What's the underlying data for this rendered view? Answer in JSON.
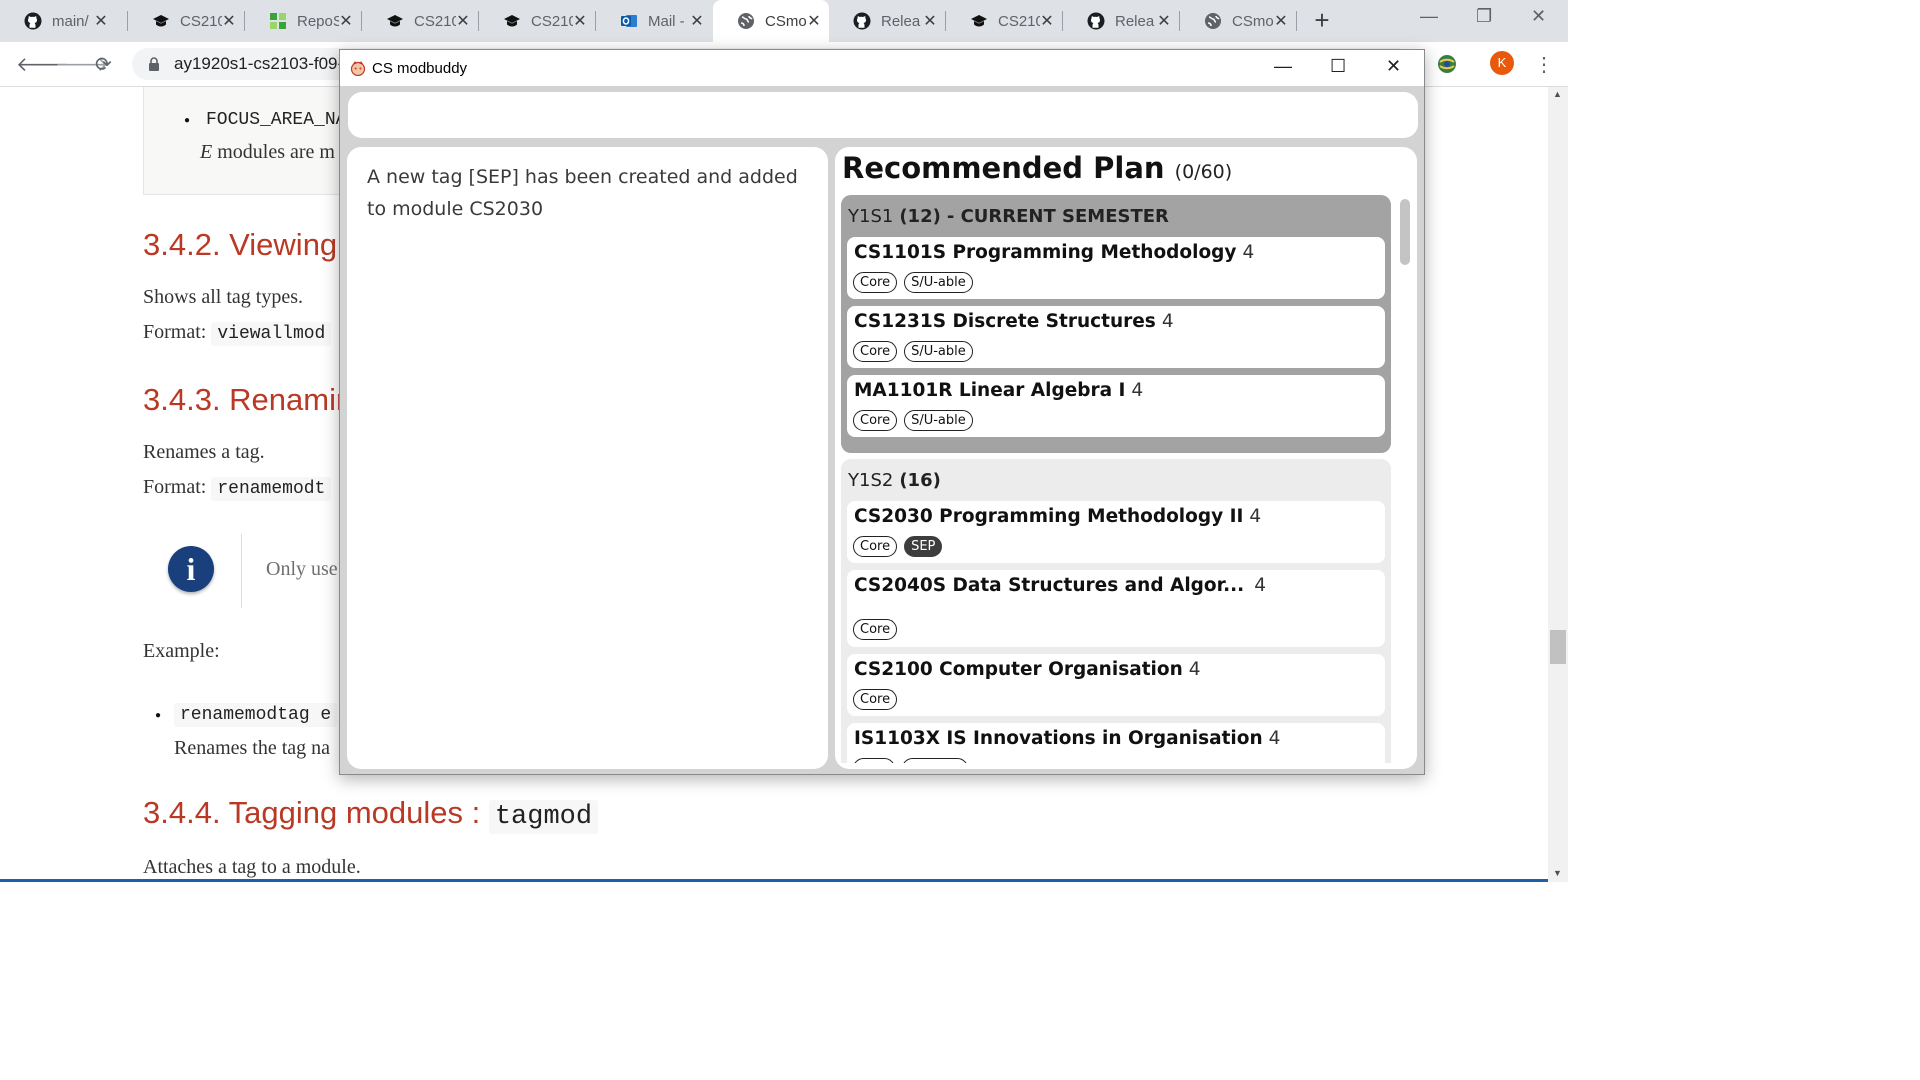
{
  "browser": {
    "tabs": [
      {
        "title": "main/",
        "icon": "github-icon"
      },
      {
        "title": "CS210",
        "icon": "graduation-cap-icon"
      },
      {
        "title": "RepoS",
        "icon": "reposense-icon"
      },
      {
        "title": "CS210",
        "icon": "graduation-cap-icon"
      },
      {
        "title": "CS210",
        "icon": "graduation-cap-icon"
      },
      {
        "title": "Mail -",
        "icon": "outlook-icon"
      },
      {
        "title": "CSmo",
        "icon": "globe-icon"
      },
      {
        "title": "Relea",
        "icon": "github-icon"
      },
      {
        "title": "CS210",
        "icon": "graduation-cap-icon"
      },
      {
        "title": "Relea",
        "icon": "github-icon"
      },
      {
        "title": "CSmo",
        "icon": "globe-icon"
      }
    ],
    "active_tab_index": 6,
    "new_tab_label": "+",
    "url": "ay1920s1-cs2103-f09-",
    "profile_initial": "K",
    "colors": {
      "tabstrip": "#dee1e6",
      "avatar": "#e8590c"
    }
  },
  "doc": {
    "focus_item": "FOCUS_AREA_NA",
    "focus_note_em": "E",
    "focus_note_rest": "modules are m",
    "h_viewing": "3.4.2. Viewing",
    "p_shows": "Shows all tag types.",
    "format_label": "Format:",
    "code_viewall": "viewallmod",
    "h_renaming": "3.4.3. Renamir",
    "p_renames": "Renames a tag.",
    "code_rename": "renamemodt",
    "note_text": "Only use",
    "example_label": "Example:",
    "ex_code": "renamemodtag e",
    "ex_desc": "Renames the tag na",
    "h_tagging": "3.4.4. Tagging modules :",
    "h_tagging_code": "tagmod",
    "p_attaches": "Attaches a tag to a module.",
    "colors": {
      "heading": "#ba3925",
      "admonition": "#19407c"
    }
  },
  "app": {
    "title": "CS modbuddy",
    "command_value": "",
    "result_text": "A new tag [SEP] has been created and added to module CS2030",
    "plan": {
      "title": "Recommended Plan",
      "credits": "(0/60)",
      "semesters": [
        {
          "name": "Y1S1",
          "credits": "(12)",
          "current_label": "- CURRENT SEMESTER",
          "modules": [
            {
              "code_name": "CS1101S Programming Methodology",
              "mc": "4",
              "tags": [
                "Core",
                "S/U-able"
              ]
            },
            {
              "code_name": "CS1231S Discrete Structures",
              "mc": "4",
              "tags": [
                "Core",
                "S/U-able"
              ]
            },
            {
              "code_name": "MA1101R Linear Algebra I",
              "mc": "4",
              "tags": [
                "Core",
                "S/U-able"
              ]
            }
          ]
        },
        {
          "name": "Y1S2",
          "credits": "(16)",
          "current_label": "",
          "modules": [
            {
              "code_name": "CS2030 Programming Methodology II",
              "mc": "4",
              "tags": [
                "Core",
                "SEP"
              ]
            },
            {
              "code_name": "CS2040S Data Structures and Algor...",
              "mc": "4",
              "tags": [
                "Core"
              ]
            },
            {
              "code_name": "CS2100 Computer Organisation",
              "mc": "4",
              "tags": [
                "Core"
              ]
            },
            {
              "code_name": "IS1103X IS Innovations in Organisation",
              "mc": "4",
              "tags": [
                "",
                ""
              ]
            }
          ]
        }
      ]
    },
    "colors": {
      "body_bg": "#d3d3d3",
      "current_sem_bg": "#a3a3a3",
      "sem_bg": "#ececec",
      "sep_tag_bg": "#3d3d3d"
    }
  }
}
